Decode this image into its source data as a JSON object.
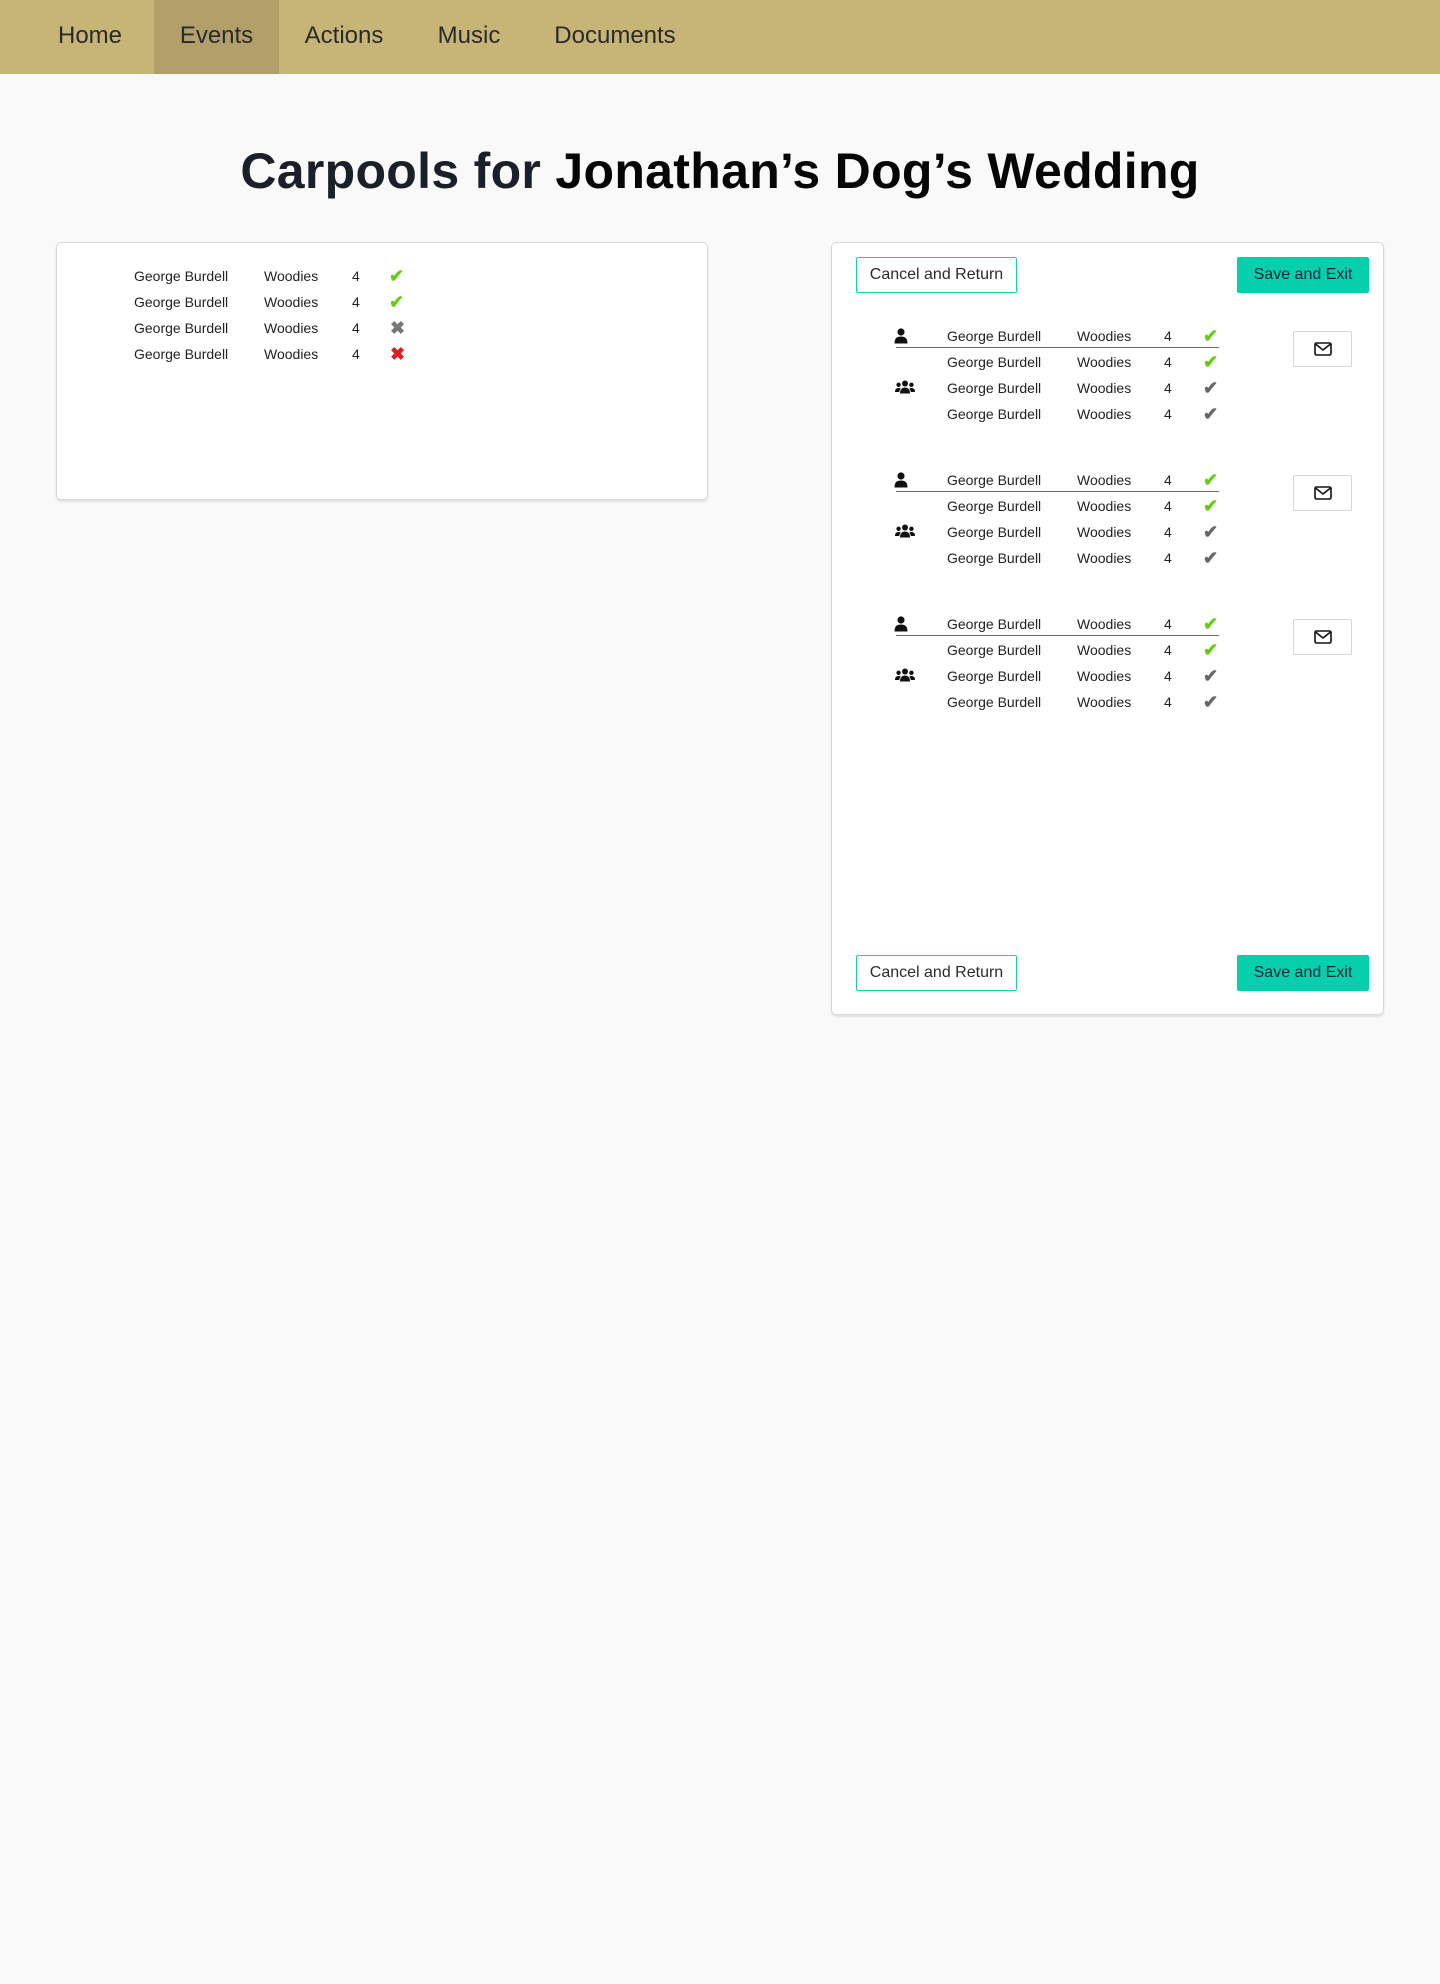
{
  "nav": {
    "items": [
      {
        "label": "Home",
        "active": false
      },
      {
        "label": "Events",
        "active": true
      },
      {
        "label": "Actions",
        "active": false
      },
      {
        "label": "Music",
        "active": false
      },
      {
        "label": "Documents",
        "active": false
      }
    ],
    "bg_color": "#c7b477",
    "active_color": "#b39f6a"
  },
  "page": {
    "title_prefix": "Carpools for ",
    "title_event": "Jonathan’s Dog’s Wedding"
  },
  "left_list": {
    "rows": [
      {
        "name": "George Burdell",
        "location": "Woodies",
        "seats": "4",
        "status": "check-green"
      },
      {
        "name": "George Burdell",
        "location": "Woodies",
        "seats": "4",
        "status": "check-green"
      },
      {
        "name": "George Burdell",
        "location": "Woodies",
        "seats": "4",
        "status": "x-grey"
      },
      {
        "name": "George Burdell",
        "location": "Woodies",
        "seats": "4",
        "status": "x-red"
      }
    ]
  },
  "editor": {
    "cancel_label": "Cancel and Return",
    "save_label": "Save and Exit",
    "accent_color": "#06cfae",
    "carpools": [
      {
        "driver_icon": "person-icon",
        "riders_icon": "users-icon",
        "mail_icon": "envelope-icon",
        "rows": [
          {
            "name": "George Burdell",
            "location": "Woodies",
            "seats": "4",
            "status": "check-green"
          },
          {
            "name": "George Burdell",
            "location": "Woodies",
            "seats": "4",
            "status": "check-green"
          },
          {
            "name": "George Burdell",
            "location": "Woodies",
            "seats": "4",
            "status": "check-grey"
          },
          {
            "name": "George Burdell",
            "location": "Woodies",
            "seats": "4",
            "status": "check-grey"
          }
        ]
      },
      {
        "driver_icon": "person-icon",
        "riders_icon": "users-icon",
        "mail_icon": "envelope-icon",
        "rows": [
          {
            "name": "George Burdell",
            "location": "Woodies",
            "seats": "4",
            "status": "check-green"
          },
          {
            "name": "George Burdell",
            "location": "Woodies",
            "seats": "4",
            "status": "check-green"
          },
          {
            "name": "George Burdell",
            "location": "Woodies",
            "seats": "4",
            "status": "check-grey"
          },
          {
            "name": "George Burdell",
            "location": "Woodies",
            "seats": "4",
            "status": "check-grey"
          }
        ]
      },
      {
        "driver_icon": "person-icon",
        "riders_icon": "users-icon",
        "mail_icon": "envelope-icon",
        "rows": [
          {
            "name": "George Burdell",
            "location": "Woodies",
            "seats": "4",
            "status": "check-green"
          },
          {
            "name": "George Burdell",
            "location": "Woodies",
            "seats": "4",
            "status": "check-green"
          },
          {
            "name": "George Burdell",
            "location": "Woodies",
            "seats": "4",
            "status": "check-grey"
          },
          {
            "name": "George Burdell",
            "location": "Woodies",
            "seats": "4",
            "status": "check-grey"
          }
        ]
      }
    ]
  }
}
